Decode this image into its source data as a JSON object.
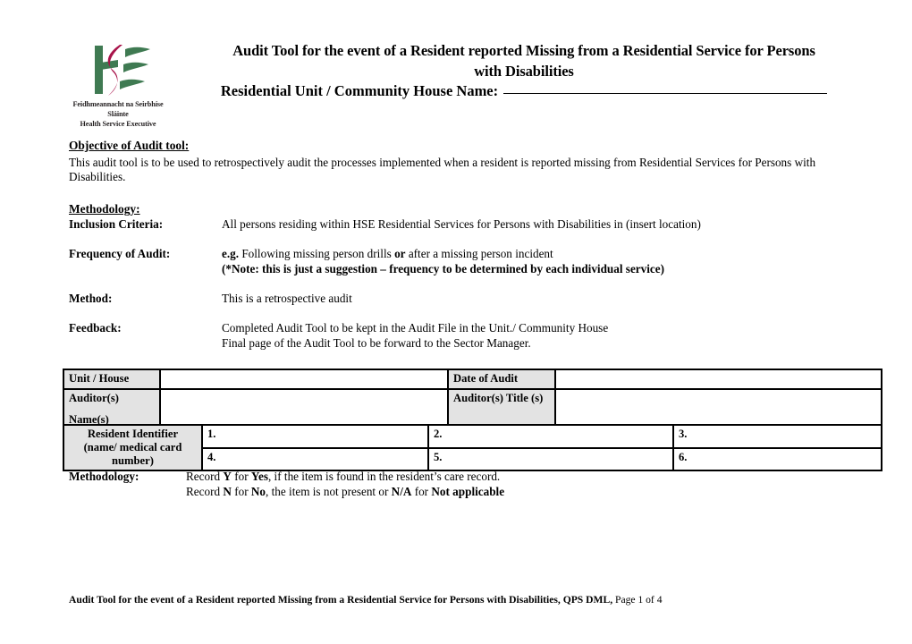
{
  "document": {
    "title_line1": "Audit Tool for the event of a Resident reported Missing from a Residential Service for Persons",
    "title_line2": "with Disabilities",
    "subtitle_label": "Residential Unit / Community House Name:"
  },
  "logo": {
    "icon_name": "hse-logo",
    "tagline_irish": "Feidhmeannacht na Seirbhíse Sláinte",
    "tagline_english": "Health Service Executive",
    "color_green": "#3f7a52",
    "color_crimson": "#a8134a"
  },
  "objective": {
    "heading": "Objective of Audit tool:",
    "body_line1": "This audit tool is to be used to retrospectively audit the processes implemented when a resident is reported missing from Residential Services for Persons",
    "body_line2": "with Disabilities."
  },
  "methodology": {
    "heading": "Methodology:",
    "rows": [
      {
        "label": "Inclusion Criteria:",
        "value": "All persons residing within HSE Residential Services for Persons with Disabilities in (insert location)"
      },
      {
        "label": "Frequency of Audit:",
        "value_bold_1": "e.g.",
        "value_plain_1": " Following missing person drills ",
        "value_bold_2": "or",
        "value_plain_2": " after a missing person incident",
        "value_line2_bold": "(*Note: this is just a suggestion – frequency to be determined by each individual service)"
      },
      {
        "label": "Method:",
        "value": "This is a retrospective audit"
      },
      {
        "label": "Feedback:",
        "value_line1": "Completed Audit Tool to be kept in the Audit File in the Unit./ Community House",
        "value_line2": "Final page of the Audit Tool to be forward to the Sector Manager."
      }
    ]
  },
  "audit_table": {
    "unit_house_label": "Unit / House",
    "unit_house_value": "",
    "date_of_audit_label": "Date of Audit",
    "date_of_audit_value": "",
    "auditor_names_label_line1": "Auditor(s)",
    "auditor_names_label_line2": "Name(s)",
    "auditor_names_value": "",
    "auditor_titles_label": "Auditor(s) Title (s)",
    "auditor_titles_value": "",
    "resident_identifier_label_line1": "Resident Identifier",
    "resident_identifier_label_line2": "(name/ medical card",
    "resident_identifier_label_line3": "number)",
    "resident_slots": [
      "1.",
      "2.",
      "3.",
      "4.",
      "5.",
      "6."
    ]
  },
  "methodology_note": {
    "label": "Methodology:",
    "line1_a": "Record ",
    "line1_b": "Y",
    "line1_c": " for ",
    "line1_d": "Yes",
    "line1_e": ", if the item is found in the resident’s care record.",
    "line2_a": "Record ",
    "line2_b": "N",
    "line2_c": " for ",
    "line2_d": "No",
    "line2_e": ", the item is not present or ",
    "line2_f": "N/A",
    "line2_g": " for ",
    "line2_h": "Not applicable"
  },
  "footer": {
    "bold_text": "Audit Tool for the event of a Resident reported Missing from a Residential Service for Persons with Disabilities, QPS DML,",
    "page_text": " Page 1 of 4"
  }
}
